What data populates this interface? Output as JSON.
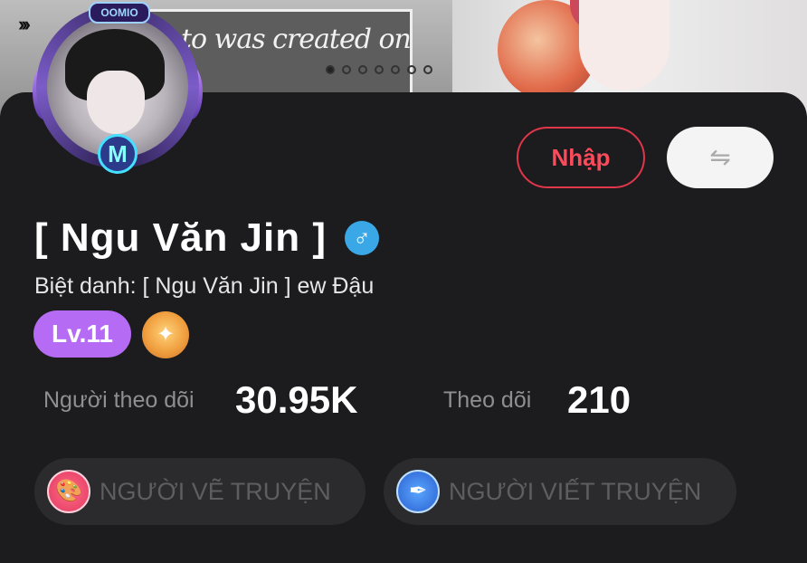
{
  "banner": {
    "text": "to was created on",
    "dot_count": 7,
    "active_dot": 0
  },
  "avatar": {
    "top_badge": "OOMIO",
    "level_badge": "M"
  },
  "actions": {
    "import_label": "Nhập",
    "swap_icon": "⇋"
  },
  "profile": {
    "name": "[ Ngu Văn Jin ]",
    "gender_icon": "♂",
    "nickname": "Biệt danh: [ Ngu Văn Jin ] ew Đậu",
    "level": "Lv.11"
  },
  "stats": {
    "followers_label": "Người theo dõi",
    "followers_value": "30.95K",
    "following_label": "Theo dõi",
    "following_value": "210"
  },
  "tags": [
    {
      "label": "NGƯỜI VẼ TRUYỆN",
      "icon": "palette-icon"
    },
    {
      "label": "NGƯỜI VIẾT TRUYỆN",
      "icon": "pen-icon"
    }
  ],
  "colors": {
    "accent_red": "#e0364a",
    "level_purple": "#b66bf5",
    "gender_blue": "#3aa7e6",
    "background": "#1c1c1e"
  }
}
